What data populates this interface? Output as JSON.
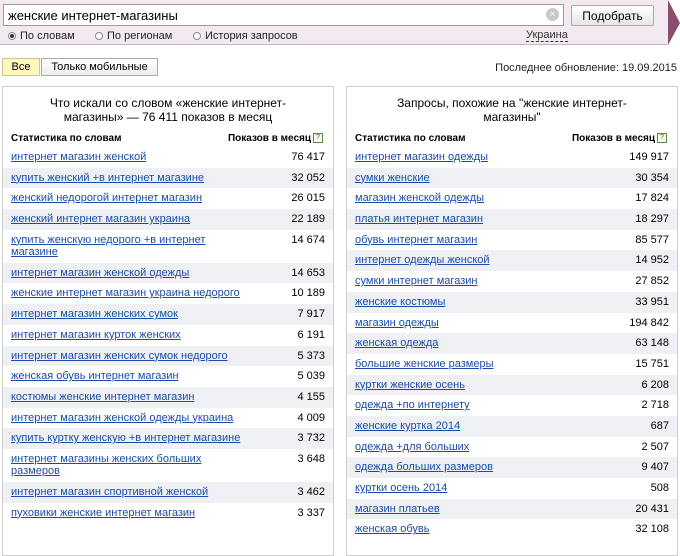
{
  "search": {
    "value": "женские интернет-магазины",
    "button_label": "Подобрать"
  },
  "modes": [
    "По словам",
    "По регионам",
    "История запросов"
  ],
  "region": "Украина",
  "filters": {
    "all": "Все",
    "mobile": "Только мобильные"
  },
  "last_update": "Последнее обновление: 19.09.2015",
  "left": {
    "title_line1": "Что искали со словом «женские интернет-",
    "title_line2": "магазины» — 76 411 показов в месяц",
    "col1": "Статистика по словам",
    "col2": "Показов в месяц",
    "rows": [
      {
        "text": "интернет магазин женской",
        "value": "76 417"
      },
      {
        "text": "купить женский +в интернет магазине",
        "value": "32 052"
      },
      {
        "text": "женский недорогой интернет магазин",
        "value": "26 015"
      },
      {
        "text": "женский интернет магазин украина",
        "value": "22 189"
      },
      {
        "text": "купить женскую недорого +в интернет магазине",
        "value": "14 674"
      },
      {
        "text": "интернет магазин женской одежды",
        "value": "14 653"
      },
      {
        "text": "женские интернет магазин украина недорого",
        "value": "10 189"
      },
      {
        "text": "интернет магазин женских сумок",
        "value": "7 917"
      },
      {
        "text": "интернет магазин курток женских",
        "value": "6 191"
      },
      {
        "text": "интернет магазин женских сумок недорого",
        "value": "5 373"
      },
      {
        "text": "женская обувь интернет магазин",
        "value": "5 039"
      },
      {
        "text": "костюмы женские интернет магазин",
        "value": "4 155"
      },
      {
        "text": "интернет магазин женской одежды украина",
        "value": "4 009"
      },
      {
        "text": "купить куртку женскую +в интернет магазине",
        "value": "3 732"
      },
      {
        "text": "интернет магазины женских больших размеров",
        "value": "3 648"
      },
      {
        "text": "интернет магазин спортивной женской",
        "value": "3 462"
      },
      {
        "text": "пуховики женские интернет магазин",
        "value": "3 337"
      }
    ]
  },
  "right": {
    "title_line1": "Запросы, похожие на \"женские интернет-",
    "title_line2": "магазины\"",
    "col1": "Статистика по словам",
    "col2": "Показов в месяц",
    "rows": [
      {
        "text": "интернет магазин одежды",
        "value": "149 917"
      },
      {
        "text": "сумки женские",
        "value": "30 354"
      },
      {
        "text": "магазин женской одежды",
        "value": "17 824"
      },
      {
        "text": "платья интернет магазин",
        "value": "18 297"
      },
      {
        "text": "обувь интернет магазин",
        "value": "85 577"
      },
      {
        "text": "интернет одежды женской",
        "value": "14 952"
      },
      {
        "text": "сумки интернет магазин",
        "value": "27 852"
      },
      {
        "text": "женские костюмы",
        "value": "33 951"
      },
      {
        "text": "магазин одежды",
        "value": "194 842"
      },
      {
        "text": "женская одежда",
        "value": "63 148"
      },
      {
        "text": "большие женские размеры",
        "value": "15 751"
      },
      {
        "text": "куртки женские осень",
        "value": "6 208"
      },
      {
        "text": "одежда +по интернету",
        "value": "2 718"
      },
      {
        "text": "женские куртка 2014",
        "value": "687"
      },
      {
        "text": "одежда +для больших",
        "value": "2 507"
      },
      {
        "text": "одежда больших размеров",
        "value": "9 407"
      },
      {
        "text": "куртки осень 2014",
        "value": "508"
      },
      {
        "text": "магазин платьев",
        "value": "20 431"
      },
      {
        "text": "женская обувь",
        "value": "32 108"
      }
    ]
  }
}
